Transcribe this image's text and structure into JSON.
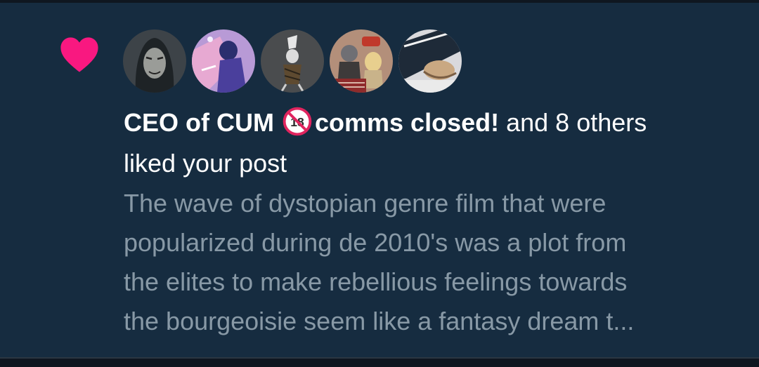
{
  "notification": {
    "type_icon": "heart-icon",
    "accent_color": "#f91880",
    "avatars": [
      {
        "name": "avatar-1",
        "bg": "#3d4348"
      },
      {
        "name": "avatar-2",
        "bg": "#b89ad6"
      },
      {
        "name": "avatar-3",
        "bg": "#4a4c4e"
      },
      {
        "name": "avatar-4",
        "bg": "#8a6a58"
      },
      {
        "name": "avatar-5",
        "bg": "#d9d9dc"
      }
    ],
    "actor_name": "CEO of CUM",
    "actor_badge": "no-under-18-icon",
    "actor_status": "comms closed!",
    "others_text": "and 8 others",
    "action_text": "liked your post",
    "preview_lines": [
      "The wave of dystopian genre film that were",
      "popularized during de 2010's was a plot from",
      "the elites to make rebellious feelings towards",
      "the bourgeoisie seem like a fantasy dream t..."
    ]
  }
}
